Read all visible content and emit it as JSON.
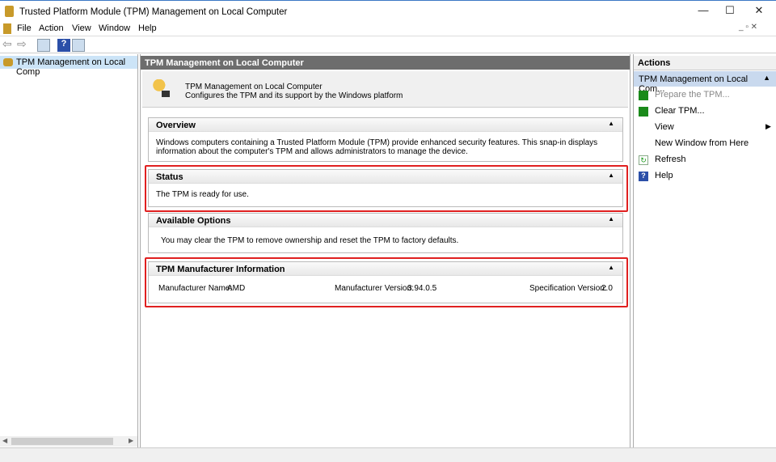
{
  "window": {
    "title": "Trusted Platform Module (TPM) Management on Local Computer",
    "min": "—",
    "max": "☐",
    "close": "✕"
  },
  "menu": [
    "File",
    "Action",
    "View",
    "Window",
    "Help"
  ],
  "tree": {
    "item": "TPM Management on Local Comp"
  },
  "center": {
    "header": "TPM Management on Local Computer",
    "banner_title": "TPM Management on Local Computer",
    "banner_sub": "Configures the TPM and its support by the Windows platform",
    "overview": {
      "title": "Overview",
      "text": "Windows computers containing a Trusted Platform Module (TPM) provide enhanced security features. This snap-in displays information about the computer's TPM and allows administrators to manage the device."
    },
    "status": {
      "title": "Status",
      "text": "The TPM is ready for use."
    },
    "options": {
      "title": "Available Options",
      "text": "You may clear the TPM to remove ownership and reset the TPM to factory defaults."
    },
    "manufacturer": {
      "title": "TPM Manufacturer Information",
      "name_label": "Manufacturer Name:",
      "name": "AMD",
      "version_label": "Manufacturer Version:",
      "version": "3.94.0.5",
      "spec_label": "Specification Version:",
      "spec": "2.0"
    }
  },
  "actions": {
    "header": "Actions",
    "group": "TPM Management on Local Com...",
    "items": [
      "Prepare the TPM...",
      "Clear TPM...",
      "View",
      "New Window from Here",
      "Refresh",
      "Help"
    ]
  },
  "colors": {
    "highlight": "#e02020",
    "header": "#6d6d6d",
    "group": "#c9d9ee"
  }
}
